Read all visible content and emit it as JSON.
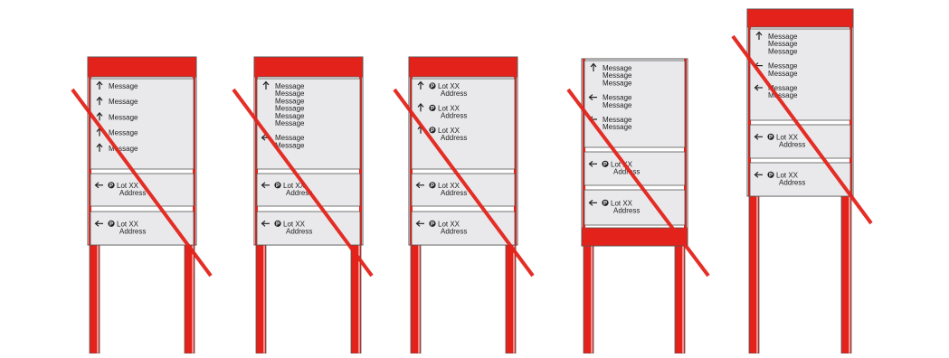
{
  "colors": {
    "accent_red": "#e3231b",
    "panel_fill": "#e9e9eb",
    "outline": "#555555",
    "strike": "#e3231b",
    "text": "#222222"
  },
  "signs": [
    {
      "id": "sign-1",
      "crossed_out": true,
      "sections": [
        {
          "type": "message",
          "rows": [
            {
              "arrow": "up",
              "lines": [
                "Message"
              ]
            },
            {
              "arrow": "up",
              "lines": [
                "Message"
              ]
            },
            {
              "arrow": "up",
              "lines": [
                "Message"
              ]
            },
            {
              "arrow": "up",
              "lines": [
                "Message"
              ]
            },
            {
              "arrow": "up",
              "lines": [
                "Message"
              ]
            }
          ]
        },
        {
          "type": "lot",
          "rows": [
            {
              "arrow": "left",
              "parking": true,
              "lines": [
                "Lot XX",
                "Address"
              ]
            }
          ]
        },
        {
          "type": "lot",
          "rows": [
            {
              "arrow": "left",
              "parking": true,
              "lines": [
                "Lot XX",
                "Address"
              ]
            }
          ]
        }
      ]
    },
    {
      "id": "sign-2",
      "crossed_out": true,
      "sections": [
        {
          "type": "message",
          "rows": [
            {
              "arrow": "up",
              "lines": [
                "Message",
                "Message",
                "Message",
                "Message",
                "Message",
                "Message"
              ]
            },
            {
              "arrow": "left",
              "lines": [
                "Message",
                "Message"
              ]
            }
          ]
        },
        {
          "type": "lot",
          "rows": [
            {
              "arrow": "left",
              "parking": true,
              "lines": [
                "Lot XX",
                "Address"
              ]
            }
          ]
        },
        {
          "type": "lot",
          "rows": [
            {
              "arrow": "left",
              "parking": true,
              "lines": [
                "Lot XX",
                "Address"
              ]
            }
          ]
        }
      ]
    },
    {
      "id": "sign-3",
      "crossed_out": true,
      "sections": [
        {
          "type": "message",
          "rows": [
            {
              "arrow": "up",
              "parking": true,
              "lines": [
                "Lot XX",
                "Address"
              ]
            },
            {
              "arrow": "up",
              "parking": true,
              "lines": [
                "Lot XX",
                "Address"
              ]
            },
            {
              "arrow": "up",
              "parking": true,
              "lines": [
                "Lot XX",
                "Address"
              ]
            }
          ]
        },
        {
          "type": "lot",
          "rows": [
            {
              "arrow": "left",
              "parking": true,
              "lines": [
                "Lot XX",
                "Address"
              ]
            }
          ]
        },
        {
          "type": "lot",
          "rows": [
            {
              "arrow": "left",
              "parking": true,
              "lines": [
                "Lot XX",
                "Address"
              ]
            }
          ]
        }
      ]
    },
    {
      "id": "sign-4",
      "crossed_out": true,
      "sections": [
        {
          "type": "message",
          "rows": [
            {
              "arrow": "up",
              "lines": [
                "Message",
                "Message",
                "Message"
              ]
            },
            {
              "arrow": "left",
              "lines": [
                "Message",
                "Message"
              ]
            },
            {
              "arrow": "left",
              "lines": [
                "Message",
                "Message"
              ]
            }
          ]
        },
        {
          "type": "lot",
          "rows": [
            {
              "arrow": "left",
              "parking": true,
              "lines": [
                "Lot XX",
                "Address"
              ]
            }
          ]
        },
        {
          "type": "lot",
          "rows": [
            {
              "arrow": "left",
              "parking": true,
              "lines": [
                "Lot XX",
                "Address"
              ]
            }
          ]
        }
      ]
    },
    {
      "id": "sign-5",
      "crossed_out": true,
      "sections": [
        {
          "type": "message",
          "rows": [
            {
              "arrow": "up",
              "lines": [
                "Message",
                "Message",
                "Message"
              ]
            },
            {
              "arrow": "left",
              "lines": [
                "Message",
                "Message"
              ]
            },
            {
              "arrow": "left",
              "lines": [
                "Message",
                "Message"
              ]
            }
          ]
        },
        {
          "type": "lot",
          "rows": [
            {
              "arrow": "left",
              "parking": true,
              "lines": [
                "Lot XX",
                "Address"
              ]
            }
          ]
        },
        {
          "type": "lot",
          "rows": [
            {
              "arrow": "left",
              "parking": true,
              "lines": [
                "Lot XX",
                "Address"
              ]
            }
          ]
        }
      ]
    }
  ]
}
